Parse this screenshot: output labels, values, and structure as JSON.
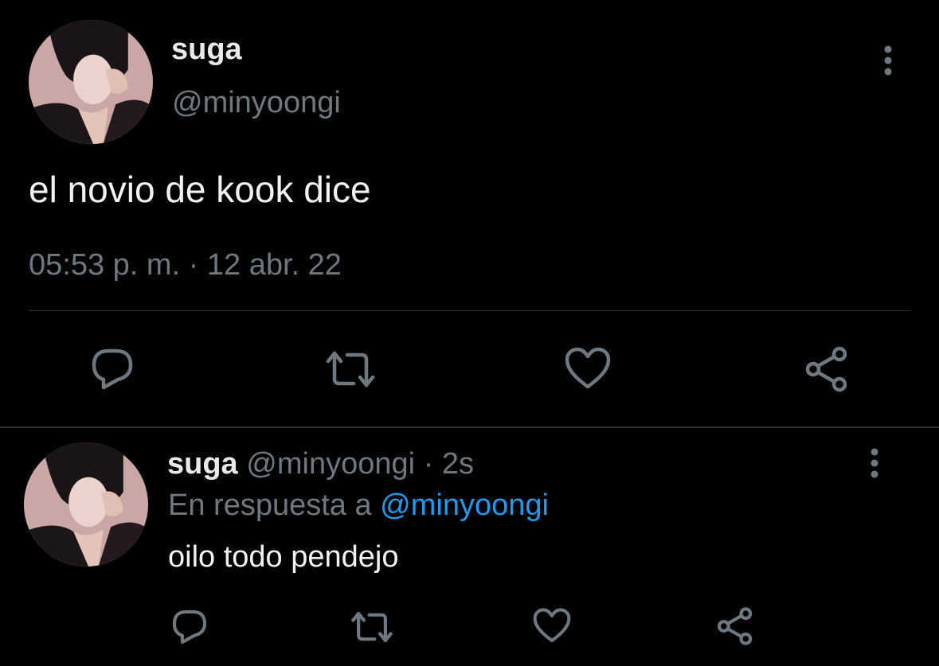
{
  "main_tweet": {
    "display_name": "suga",
    "handle": "@minyoongi",
    "text": "el novio de kook dice",
    "timestamp": "05:53 p. m. · 12 abr. 22",
    "more_icon": "more-vertical-icon",
    "actions": [
      "reply-icon",
      "retweet-icon",
      "like-icon",
      "share-icon"
    ]
  },
  "reply_tweet": {
    "display_name": "suga",
    "handle": "@minyoongi",
    "time_separator": "·",
    "time": "2s",
    "in_reply_prefix": "En respuesta a",
    "in_reply_handle": "@minyoongi",
    "text": "oilo todo pendejo",
    "more_icon": "more-vertical-icon",
    "actions": [
      "reply-icon",
      "retweet-icon",
      "like-icon",
      "share-icon"
    ]
  },
  "colors": {
    "background": "#000000",
    "text": "#e7e9ea",
    "muted": "#6e7881",
    "link": "#1d9bf0",
    "divider": "#2f3336"
  }
}
